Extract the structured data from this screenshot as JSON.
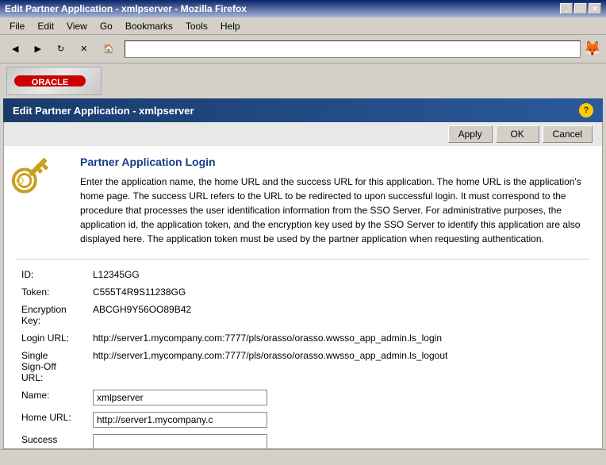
{
  "window": {
    "title": "Edit Partner Application - xmlpserver - Mozilla Firefox",
    "controls": {
      "minimize": "_",
      "maximize": "□",
      "close": "✕"
    }
  },
  "menubar": {
    "items": [
      {
        "label": "File",
        "id": "file"
      },
      {
        "label": "Edit",
        "id": "edit"
      },
      {
        "label": "View",
        "id": "view"
      },
      {
        "label": "Go",
        "id": "go"
      },
      {
        "label": "Bookmarks",
        "id": "bookmarks"
      },
      {
        "label": "Tools",
        "id": "tools"
      },
      {
        "label": "Help",
        "id": "help"
      }
    ]
  },
  "page_title_bar": {
    "title": "Edit Partner Application - xmlpserver",
    "help_icon": "?"
  },
  "action_buttons": {
    "apply": "Apply",
    "ok": "OK",
    "cancel": "Cancel"
  },
  "content": {
    "section_title": "Partner Application Login",
    "description": "Enter the application name, the home URL and the success URL for this application. The home URL is the application's home page. The success URL refers to the URL to be redirected to upon successful login. It must correspond to the procedure that processes the user identification information from the SSO Server. For administrative purposes, the application id, the application token, and the encryption key used by the SSO Server to identify this application are also displayed here. The application token must be used by the partner application when requesting authentication.",
    "fields": [
      {
        "label": "ID:",
        "value": "L12345GG",
        "type": "static",
        "id": "id-field"
      },
      {
        "label": "Token:",
        "value": "C555T4R9S11238GG",
        "type": "static",
        "id": "token-field"
      },
      {
        "label": "Encryption Key:",
        "value": "ABCGH9Y56OO89B42",
        "type": "static",
        "id": "encryption-field"
      },
      {
        "label": "Login URL:",
        "value": "http://server1.mycompany.com:7777/pls/orasso/orasso.wwsso_app_admin.ls_login",
        "type": "static",
        "id": "login-url-field"
      },
      {
        "label": "Single Sign-Off URL:",
        "value": "http://server1.mycompany.com:7777/pls/orasso/orasso.wwsso_app_admin.ls_logout",
        "type": "static",
        "id": "signoff-url-field"
      },
      {
        "label": "Name:",
        "value": "xmlpserver",
        "type": "input",
        "id": "name-field"
      },
      {
        "label": "Home URL:",
        "value": "http://server1.mycompany.c",
        "type": "input",
        "id": "home-url-field"
      },
      {
        "label": "Success",
        "value": "",
        "type": "input",
        "id": "success-field"
      }
    ]
  },
  "status": ""
}
